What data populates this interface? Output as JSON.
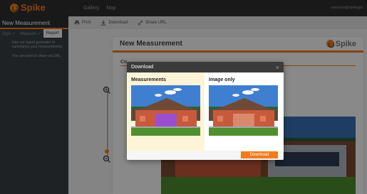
{
  "app": {
    "logo_text": "Spike"
  },
  "nav": {
    "items": [
      "Gallery",
      "Map"
    ],
    "account": "xxxxxxxx@spikegps"
  },
  "sidebar": {
    "title": "New Measurement",
    "steps": [
      "Sign ✓",
      "Measure ✓",
      "Report"
    ],
    "text1": "Use our report generator to summarize your measurements.",
    "text2": "You can print or share via URL."
  },
  "toolbar": {
    "print": "Print",
    "download": "Download",
    "share": "Share URL"
  },
  "report": {
    "title": "New Measurement",
    "logo_text": "Spike",
    "sub": "Co"
  },
  "modal": {
    "title": "Download",
    "close": "×",
    "option1": "Measurements",
    "option2": "Image only",
    "button": "Download"
  },
  "colors": {
    "accent": "#f07c1c",
    "topbar": "#2f2f2f",
    "sidebar": "#3a3f44",
    "highlight": "#fdf4d7",
    "overlay_box": "#9b4fd0"
  }
}
